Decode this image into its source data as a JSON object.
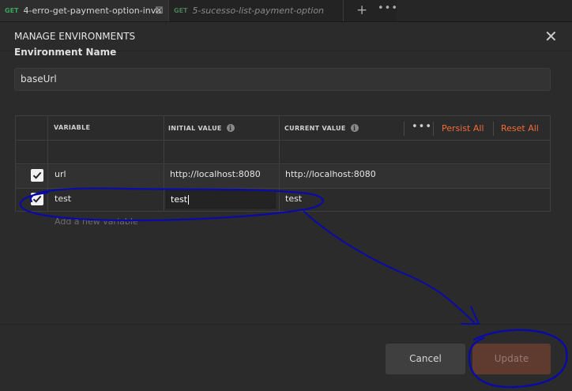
{
  "tabs": [
    {
      "method": "GET",
      "label": "4-erro-get-payment-option-inva",
      "close": "⊠",
      "active": true
    },
    {
      "method": "GET",
      "label": "5-sucesso-list-payment-option",
      "active": false
    }
  ],
  "tabbar": {
    "new_tab": "+",
    "more": "•••"
  },
  "modal": {
    "title": "MANAGE ENVIRONMENTS",
    "close": "✕",
    "env_name_label": "Environment Name",
    "env_name_value": "baseUrl"
  },
  "table": {
    "headers": {
      "variable": "VARIABLE",
      "initial": "INITIAL VALUE",
      "current": "CURRENT VALUE"
    },
    "more": "•••",
    "persist_all": "Persist All",
    "reset_all": "Reset All",
    "rows": [
      {
        "checked": true,
        "variable": "url",
        "initial": "http://localhost:8080",
        "current": "http://localhost:8080"
      },
      {
        "checked": true,
        "variable": "test",
        "initial": "test",
        "current": "test",
        "editing": "initial"
      }
    ],
    "new_placeholder": "Add a new variable"
  },
  "footer": {
    "cancel": "Cancel",
    "update": "Update"
  },
  "colors": {
    "accent": "#f26b3a",
    "annotation": "#0a0aa8",
    "check": "#f2f2f2"
  }
}
